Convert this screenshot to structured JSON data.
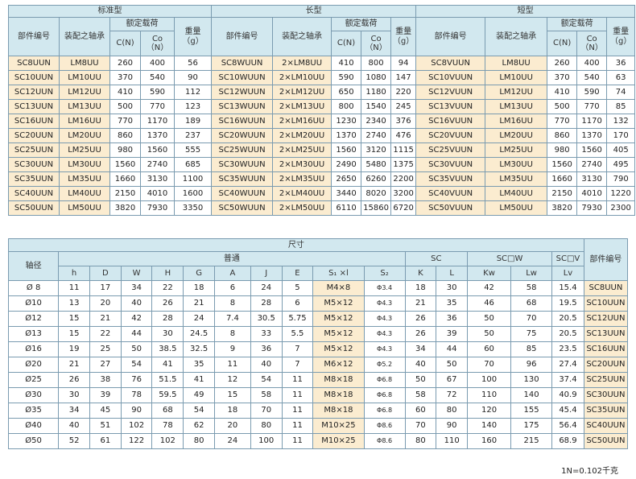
{
  "top_table": {
    "groups": [
      "标准型",
      "长型",
      "短型"
    ],
    "part_no": "部件编号",
    "bearing": "装配之轴承",
    "rated_load": "额定载荷",
    "c": "C(N)",
    "co_1": "Co",
    "co_2": "（N）",
    "weight_1": "重量",
    "weight_2": "（g）",
    "rows": [
      [
        "SC8UUN",
        "LM8UU",
        "260",
        "400",
        "56",
        "SC8WUUN",
        "2×LM8UU",
        "410",
        "800",
        "94",
        "SC8VUUN",
        "LM8UU",
        "260",
        "400",
        "36"
      ],
      [
        "SC10UUN",
        "LM10UU",
        "370",
        "540",
        "90",
        "SC10WUUN",
        "2×LM10UU",
        "590",
        "1080",
        "147",
        "SC10VUUN",
        "LM10UU",
        "370",
        "540",
        "63"
      ],
      [
        "SC12UUN",
        "LM12UU",
        "410",
        "590",
        "112",
        "SC12WUUN",
        "2×LM12UU",
        "650",
        "1180",
        "220",
        "SC12VUUN",
        "LM12UU",
        "410",
        "590",
        "74"
      ],
      [
        "SC13UUN",
        "LM13UU",
        "500",
        "770",
        "123",
        "SC13WUUN",
        "2×LM13UU",
        "800",
        "1540",
        "245",
        "SC13VUUN",
        "LM13UU",
        "500",
        "770",
        "85"
      ],
      [
        "SC16UUN",
        "LM16UU",
        "770",
        "1170",
        "189",
        "SC16WUUN",
        "2×LM16UU",
        "1230",
        "2340",
        "376",
        "SC16VUUN",
        "LM16UU",
        "770",
        "1170",
        "132"
      ],
      [
        "SC20UUN",
        "LM20UU",
        "860",
        "1370",
        "237",
        "SC20WUUN",
        "2×LM20UU",
        "1370",
        "2740",
        "476",
        "SC20VUUN",
        "LM20UU",
        "860",
        "1370",
        "170"
      ],
      [
        "SC25UUN",
        "LM25UU",
        "980",
        "1560",
        "555",
        "SC25WUUN",
        "2×LM25UU",
        "1560",
        "3120",
        "1115",
        "SC25VUUN",
        "LM25UU",
        "980",
        "1560",
        "405"
      ],
      [
        "SC30UUN",
        "LM30UU",
        "1560",
        "2740",
        "685",
        "SC30WUUN",
        "2×LM30UU",
        "2490",
        "5480",
        "1375",
        "SC30VUUN",
        "LM30UU",
        "1560",
        "2740",
        "495"
      ],
      [
        "SC35UUN",
        "LM35UU",
        "1660",
        "3130",
        "1100",
        "SC35WUUN",
        "2×LM35UU",
        "2650",
        "6260",
        "2200",
        "SC35VUUN",
        "LM35UU",
        "1660",
        "3130",
        "790"
      ],
      [
        "SC40UUN",
        "LM40UU",
        "2150",
        "4010",
        "1600",
        "SC40WUUN",
        "2×LM40UU",
        "3440",
        "8020",
        "3200",
        "SC40VUUN",
        "LM40UU",
        "2150",
        "4010",
        "1220"
      ],
      [
        "SC50UUN",
        "LM50UU",
        "3820",
        "7930",
        "3350",
        "SC50WUUN",
        "2×LM50UU",
        "6110",
        "15860",
        "6720",
        "SC50VUUN",
        "LM50UU",
        "3820",
        "7930",
        "2300"
      ]
    ]
  },
  "dim_table": {
    "title": "尺寸",
    "shaft": "轴径",
    "common": "普通",
    "sc": "SC",
    "scw": "SC□W",
    "scv": "SC□V",
    "part_no": "部件编号",
    "cols": [
      "h",
      "D",
      "W",
      "H",
      "G",
      "A",
      "J",
      "E",
      "S₁ ×l",
      "S₂",
      "K",
      "L",
      "Kw",
      "Lw",
      "Lv"
    ],
    "rows": [
      [
        "Ø 8",
        "11",
        "17",
        "34",
        "22",
        "18",
        "6",
        "24",
        "5",
        "M4×8",
        "Φ3.4",
        "18",
        "30",
        "42",
        "58",
        "15.4",
        "SC8UUN"
      ],
      [
        "Ø10",
        "13",
        "20",
        "40",
        "26",
        "21",
        "8",
        "28",
        "6",
        "M5×12",
        "Φ4.3",
        "21",
        "35",
        "46",
        "68",
        "19.5",
        "SC10UUN"
      ],
      [
        "Ø12",
        "15",
        "21",
        "42",
        "28",
        "24",
        "7.4",
        "30.5",
        "5.75",
        "M5×12",
        "Φ4.3",
        "26",
        "36",
        "50",
        "70",
        "20.5",
        "SC12UUN"
      ],
      [
        "Ø13",
        "15",
        "22",
        "44",
        "30",
        "24.5",
        "8",
        "33",
        "5.5",
        "M5×12",
        "Φ4.3",
        "26",
        "39",
        "50",
        "75",
        "20.5",
        "SC13UUN"
      ],
      [
        "Ø16",
        "19",
        "25",
        "50",
        "38.5",
        "32.5",
        "9",
        "36",
        "7",
        "M5×12",
        "Φ4.3",
        "34",
        "44",
        "60",
        "85",
        "23.5",
        "SC16UUN"
      ],
      [
        "Ø20",
        "21",
        "27",
        "54",
        "41",
        "35",
        "11",
        "40",
        "7",
        "M6×12",
        "Φ5.2",
        "40",
        "50",
        "70",
        "96",
        "27.4",
        "SC20UUN"
      ],
      [
        "Ø25",
        "26",
        "38",
        "76",
        "51.5",
        "41",
        "12",
        "54",
        "11",
        "M8×18",
        "Φ6.8",
        "50",
        "67",
        "100",
        "130",
        "37.4",
        "SC25UUN"
      ],
      [
        "Ø30",
        "30",
        "39",
        "78",
        "59.5",
        "49",
        "15",
        "58",
        "11",
        "M8×18",
        "Φ6.8",
        "58",
        "72",
        "110",
        "140",
        "40.9",
        "SC30UUN"
      ],
      [
        "Ø35",
        "34",
        "45",
        "90",
        "68",
        "54",
        "18",
        "70",
        "11",
        "M8×18",
        "Φ6.8",
        "60",
        "80",
        "120",
        "155",
        "45.4",
        "SC35UUN"
      ],
      [
        "Ø40",
        "40",
        "51",
        "102",
        "78",
        "62",
        "20",
        "80",
        "11",
        "M10×25",
        "Φ8.6",
        "70",
        "90",
        "140",
        "175",
        "56.4",
        "SC40UUN"
      ],
      [
        "Ø50",
        "52",
        "61",
        "122",
        "102",
        "80",
        "24",
        "100",
        "11",
        "M10×25",
        "Φ8.6",
        "80",
        "110",
        "160",
        "215",
        "68.9",
        "SC50UUN"
      ]
    ]
  },
  "footnote": "1N=0.102千克"
}
